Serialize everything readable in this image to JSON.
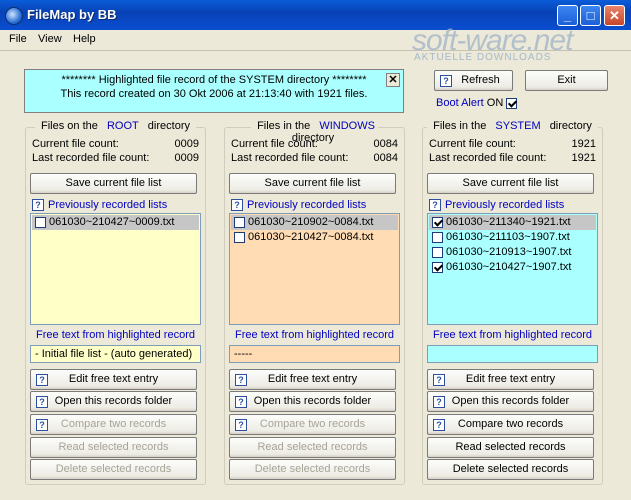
{
  "window": {
    "title": "FileMap by BB"
  },
  "menu": [
    "File",
    "View",
    "Help"
  ],
  "watermark": {
    "main": "soft-ware.net",
    "sub": "AKTUELLE DOWNLOADS"
  },
  "banner": {
    "line1": "******** Highlighted file record of the SYSTEM directory ********",
    "line2": "This record created on 30 Okt 2006 at 21:13:40 with 1921 files.",
    "close_label": "✕"
  },
  "toolbar": {
    "refresh_label": "Refresh",
    "exit_label": "Exit"
  },
  "boot_alert": {
    "label": "Boot Alert",
    "state": "ON",
    "checked": true
  },
  "common": {
    "current_label": "Current file count:",
    "last_label": "Last recorded file count:",
    "save_label": "Save current file list",
    "prev_label": "Previously recorded  lists",
    "free_label": "Free text from highlighted record",
    "edit_label": "Edit free text entry",
    "open_label": "Open this records folder",
    "compare_label": "Compare two records",
    "read_label": "Read selected records",
    "delete_label": "Delete selected records",
    "help_glyph": "?"
  },
  "panels": [
    {
      "prefix": "Files on the",
      "dir": "ROOT",
      "suffix": "directory",
      "current": "0009",
      "last": "0009",
      "list_bg": "#ffffc8",
      "items": [
        {
          "name": "061030~210427~0009.txt",
          "checked": false,
          "selected": true
        }
      ],
      "free_text": " - Initial file list - (auto generated)",
      "free_bg": "#ffffc8",
      "compare_enabled": false,
      "read_enabled": false,
      "delete_enabled": false
    },
    {
      "prefix": "Files in the",
      "dir": "WINDOWS",
      "suffix": "directory",
      "current": "0084",
      "last": "0084",
      "list_bg": "#ffdcb4",
      "items": [
        {
          "name": "061030~210902~0084.txt",
          "checked": false,
          "selected": true
        },
        {
          "name": "061030~210427~0084.txt",
          "checked": false,
          "selected": false
        }
      ],
      "free_text": "-----",
      "free_bg": "#ffdcb4",
      "compare_enabled": false,
      "read_enabled": false,
      "delete_enabled": false
    },
    {
      "prefix": "Files in the",
      "dir": "SYSTEM",
      "suffix": "directory",
      "current": "1921",
      "last": "1921",
      "list_bg": "#aaffff",
      "items": [
        {
          "name": "061030~211340~1921.txt",
          "checked": true,
          "selected": true
        },
        {
          "name": "061030~211103~1907.txt",
          "checked": false,
          "selected": false
        },
        {
          "name": "061030~210913~1907.txt",
          "checked": false,
          "selected": false
        },
        {
          "name": "061030~210427~1907.txt",
          "checked": true,
          "selected": false
        }
      ],
      "free_text": "",
      "free_bg": "#aaffff",
      "compare_enabled": true,
      "read_enabled": true,
      "delete_enabled": true
    }
  ]
}
